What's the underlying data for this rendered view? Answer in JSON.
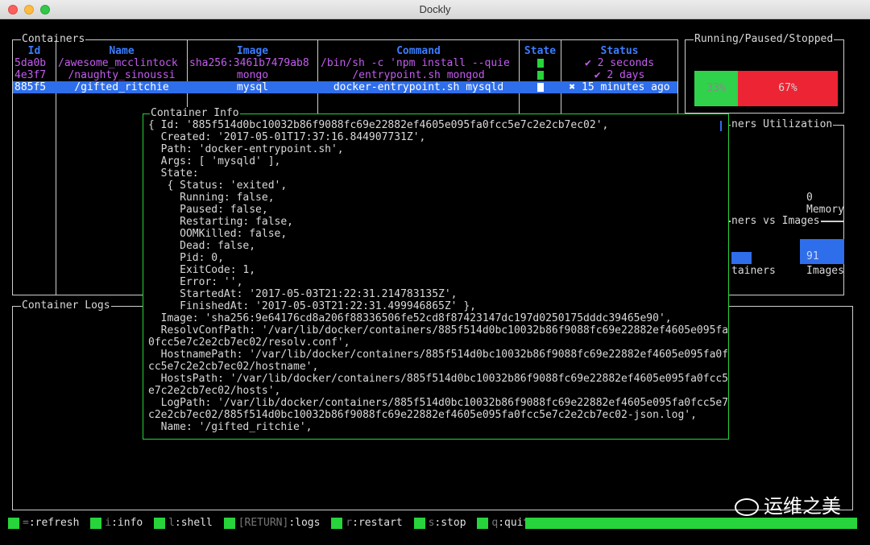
{
  "window": {
    "title": "Dockly"
  },
  "containers": {
    "label": "Containers",
    "headers": {
      "id": "Id",
      "name": "Name",
      "image": "Image",
      "command": "Command",
      "state": "State",
      "status": "Status"
    },
    "rows": [
      {
        "id": "5da0b",
        "name": "/awesome_mcclintock",
        "image": "sha256:3461b7479ab8",
        "command": "/bin/sh -c 'npm install --quie",
        "status": "✔ 2 seconds"
      },
      {
        "id": "4e3f7",
        "name": "/naughty_sinoussi",
        "image": "mongo",
        "command": "/entrypoint.sh mongod",
        "status": "✔ 2 days"
      },
      {
        "id": "885f5",
        "name": "/gifted_ritchie",
        "image": "mysql",
        "command": "docker-entrypoint.sh mysqld",
        "status": "✖ 15 minutes ago"
      }
    ]
  },
  "running": {
    "label": "Running/Paused/Stopped",
    "green_label": "33%",
    "red_label": "67%",
    "green_fraction": 0.33,
    "red_fraction": 0.67,
    "green_color": "#2fd24a",
    "red_color": "#ec2434"
  },
  "utilization": {
    "label": "ners Utilization",
    "value": "0",
    "sublabel": "Memory"
  },
  "vs": {
    "label": "ners vs Images",
    "containers_label": "tainers",
    "images_label": "Images",
    "images_value": "91"
  },
  "logs": {
    "label": "Container Logs"
  },
  "info": {
    "label": "Container Info",
    "text": "{ Id: '885f514d0bc10032b86f9088fc69e22882ef4605e095fa0fcc5e7c2e2cb7ec02',\n  Created: '2017-05-01T17:37:16.844907731Z',\n  Path: 'docker-entrypoint.sh',\n  Args: [ 'mysqld' ],\n  State:\n   { Status: 'exited',\n     Running: false,\n     Paused: false,\n     Restarting: false,\n     OOMKilled: false,\n     Dead: false,\n     Pid: 0,\n     ExitCode: 1,\n     Error: '',\n     StartedAt: '2017-05-03T21:22:31.214783135Z',\n     FinishedAt: '2017-05-03T21:22:31.499946865Z' },\n  Image: 'sha256:9e64176cd8a206f88336506fe52cd8f87423147dc197d0250175dddc39465e90',\n  ResolvConfPath: '/var/lib/docker/containers/885f514d0bc10032b86f9088fc69e22882ef4605e095fa\n0fcc5e7c2e2cb7ec02/resolv.conf',\n  HostnamePath: '/var/lib/docker/containers/885f514d0bc10032b86f9088fc69e22882ef4605e095fa0f\ncc5e7c2e2cb7ec02/hostname',\n  HostsPath: '/var/lib/docker/containers/885f514d0bc10032b86f9088fc69e22882ef4605e095fa0fcc5\ne7c2e2cb7ec02/hosts',\n  LogPath: '/var/lib/docker/containers/885f514d0bc10032b86f9088fc69e22882ef4605e095fa0fcc5e7\nc2e2cb7ec02/885f514d0bc10032b86f9088fc69e22882ef4605e095fa0fcc5e7c2e2cb7ec02-json.log',\n  Name: '/gifted_ritchie',"
  },
  "footer": {
    "items": [
      {
        "key": "=",
        "action": ":refresh"
      },
      {
        "key": "i",
        "action": ":info"
      },
      {
        "key": "l",
        "action": ":shell"
      },
      {
        "key": "[RETURN]",
        "action": ":logs"
      },
      {
        "key": "r",
        "action": ":restart"
      },
      {
        "key": "s",
        "action": ":stop"
      },
      {
        "key": "q",
        "action": ":quit"
      }
    ]
  },
  "watermark": {
    "text": "运维之美"
  },
  "colors": {
    "accent": "#3b7cff",
    "selection": "#2f6eea",
    "ok": "#27d43b",
    "error": "#ec2434",
    "name": "#c45cf0"
  }
}
